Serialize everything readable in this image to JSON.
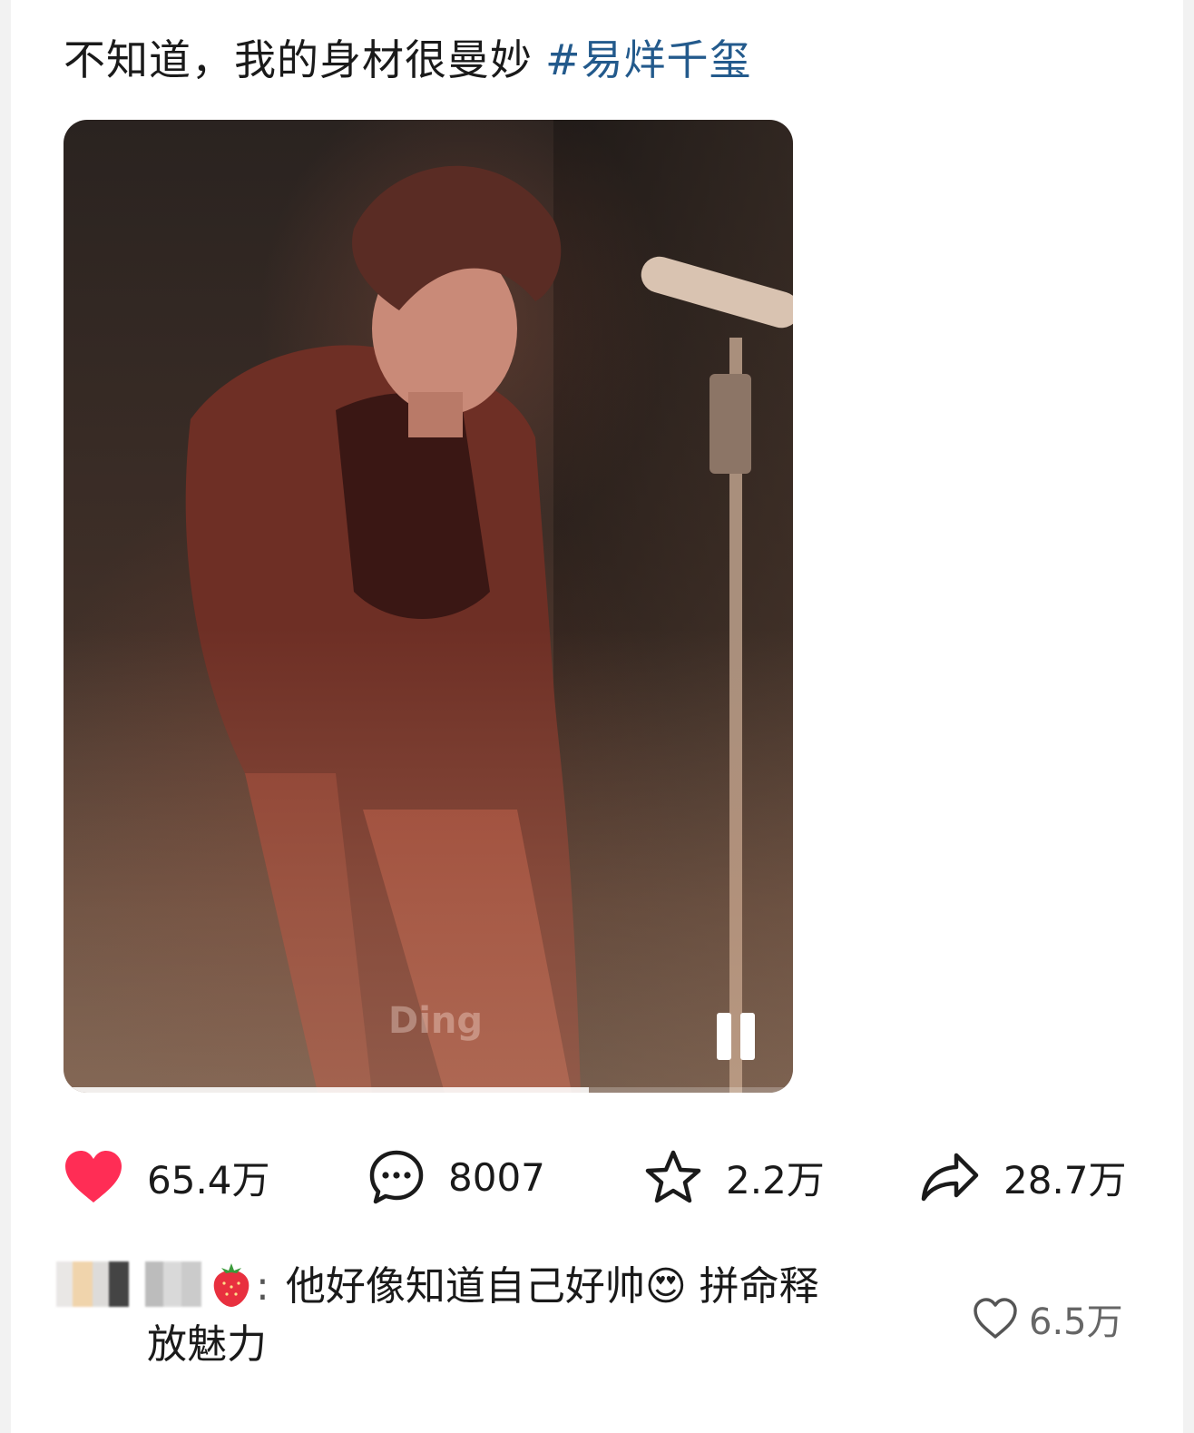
{
  "post": {
    "text": "不知道，我的身材很曼妙",
    "hashtag": "#易烊千玺"
  },
  "video": {
    "watermark": "Ding",
    "state": "playing",
    "progress": 0.72
  },
  "actions": {
    "like_count": "65.4万",
    "comment_count": "8007",
    "favorite_count": "2.2万",
    "share_count": "28.7万",
    "like_color": "#ff2d55"
  },
  "comment": {
    "separator": ":",
    "text_line1": "他好像知道自己好帅😍 拼命释",
    "text_line2": "放魅力",
    "like_count": "6.5万"
  },
  "colors": {
    "hashtag": "#235a8c",
    "text": "#1a1a1a"
  }
}
